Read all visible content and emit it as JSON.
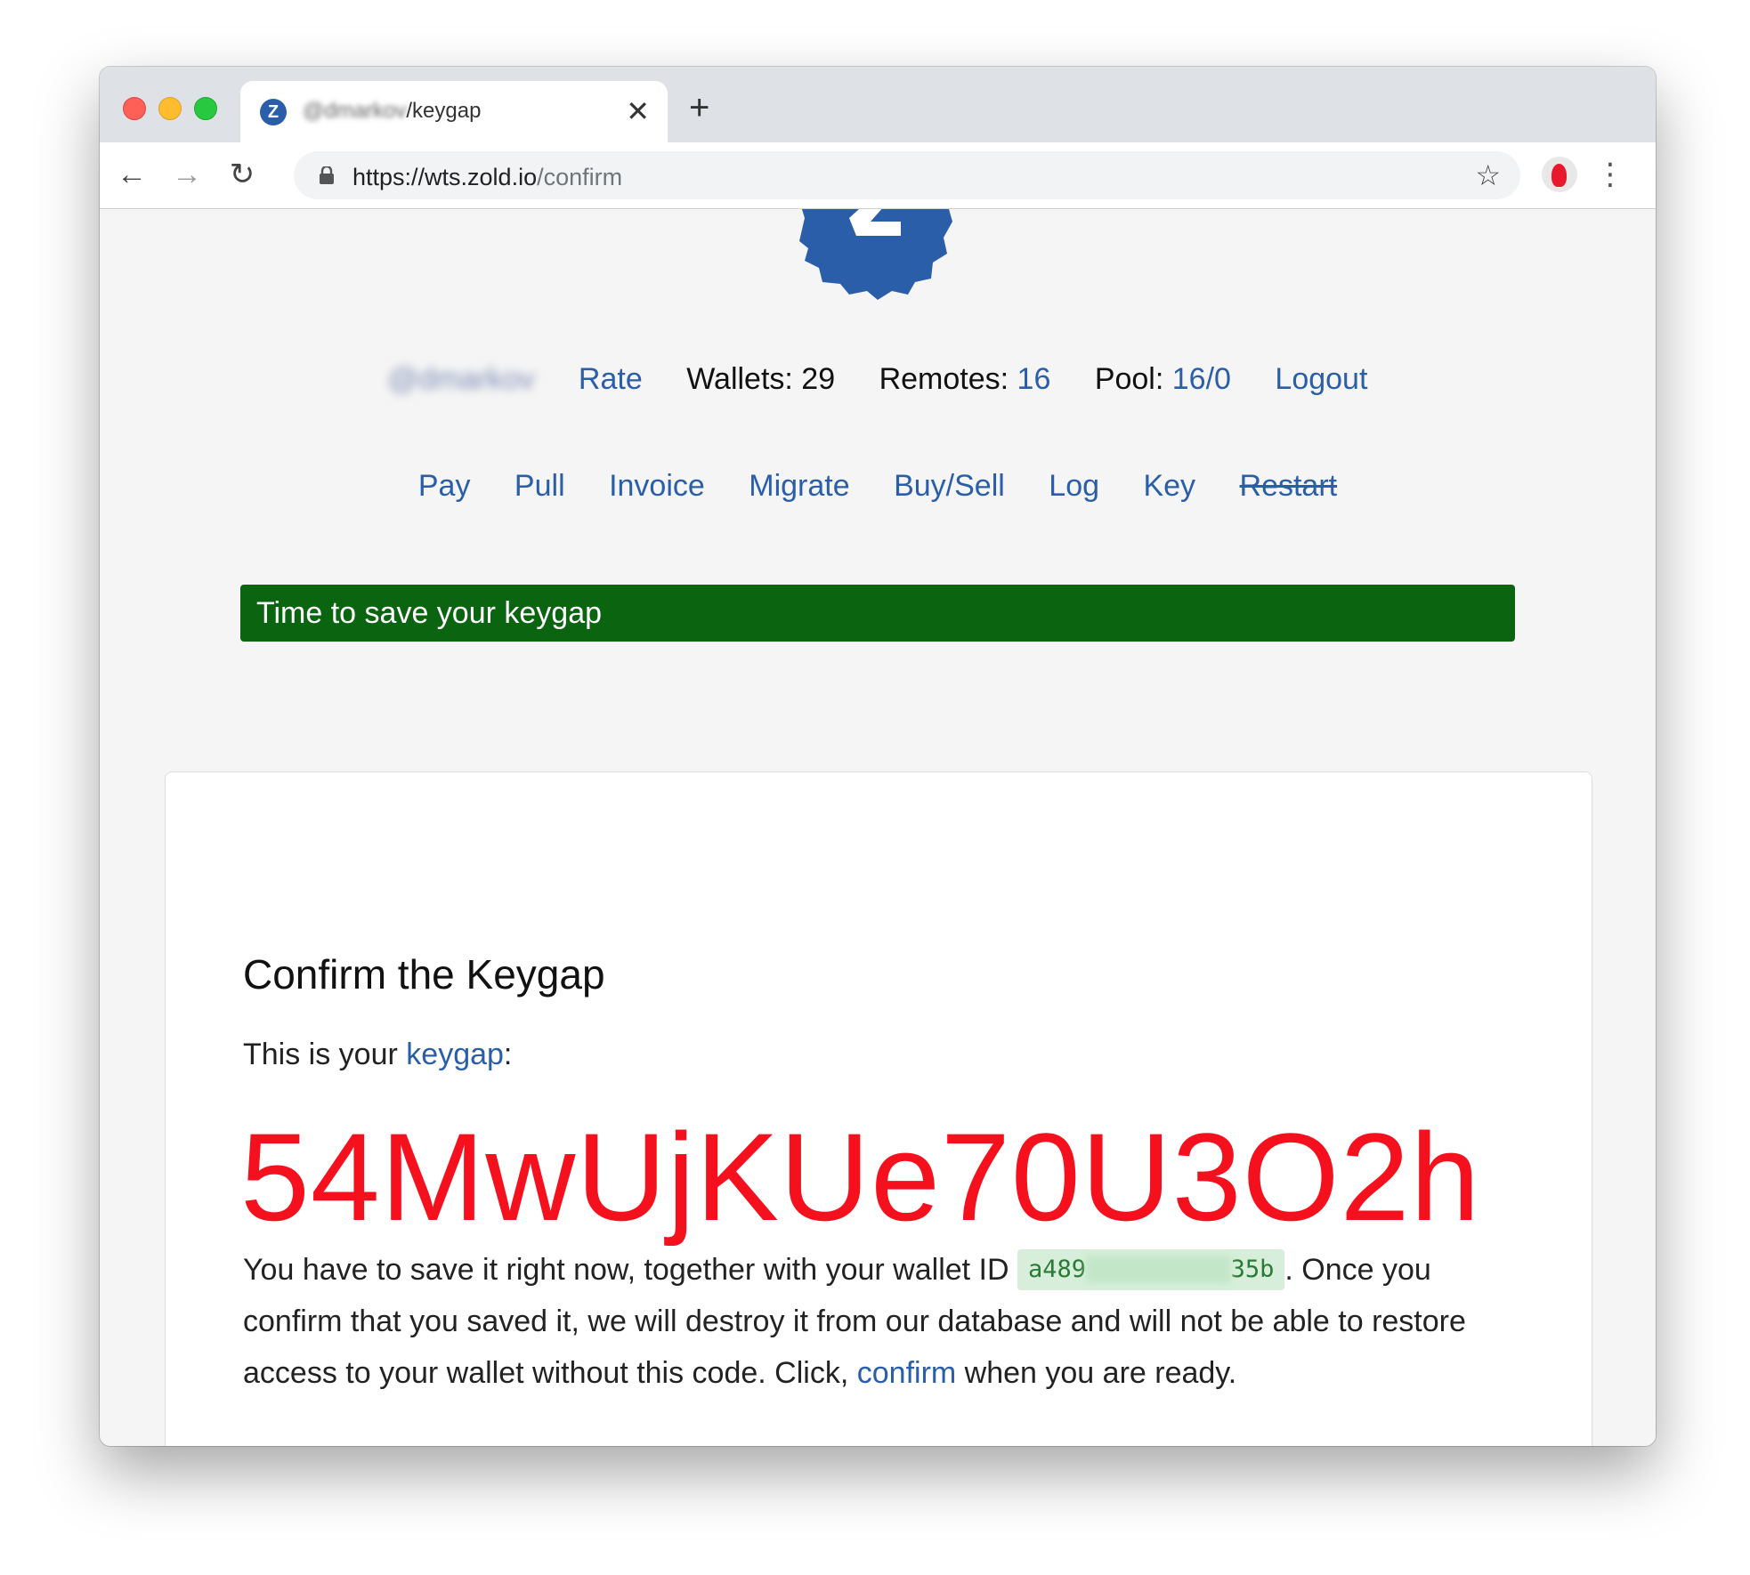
{
  "browser": {
    "tab": {
      "title_blurred": "@dmarkov",
      "title": "/keygap",
      "favicon_letter": "Z"
    },
    "icons": {
      "close": "close-icon",
      "new_tab": "plus-icon",
      "back": "arrow-left-icon",
      "forward": "arrow-right-icon",
      "reload": "reload-icon",
      "lock": "lock-icon",
      "bookmark": "star-icon",
      "menu": "kebab-menu-icon"
    },
    "url": {
      "host": "https://wts.zold.io",
      "path": "/confirm"
    }
  },
  "nav": {
    "username": "@dmarkov",
    "rate": "Rate",
    "wallets_label": "Wallets: 29",
    "remotes_label": "Remotes:",
    "remotes_value": "16",
    "pool_label": "Pool:",
    "pool_value": "16/0",
    "logout": "Logout"
  },
  "menu": {
    "items": [
      "Pay",
      "Pull",
      "Invoice",
      "Migrate",
      "Buy/Sell",
      "Log",
      "Key"
    ],
    "restart": "Restart"
  },
  "flash": "Time to save your keygap",
  "card": {
    "title": "Confirm the Keygap",
    "intro_prefix": "This is your",
    "intro_link": "keygap",
    "intro_suffix": ":",
    "keygap": "54MwUjKUe70U3O2h",
    "text_1": "You have to save it right now, together with your wallet ID",
    "wallet_id_start": "a489",
    "wallet_id_hidden": "xxxxxxxxxx",
    "wallet_id_end": "35b",
    "text_2": ". Once you confirm that you saved it, we will destroy it from our database and will not be able to restore access to your wallet without this code. Click,",
    "confirm_link": "confirm",
    "text_3": "when you are ready."
  },
  "colors": {
    "link": "#2a5ea8",
    "flash_bg": "#0a6410",
    "keygap": "#f5101e",
    "wallet_bg": "#d7efda"
  }
}
